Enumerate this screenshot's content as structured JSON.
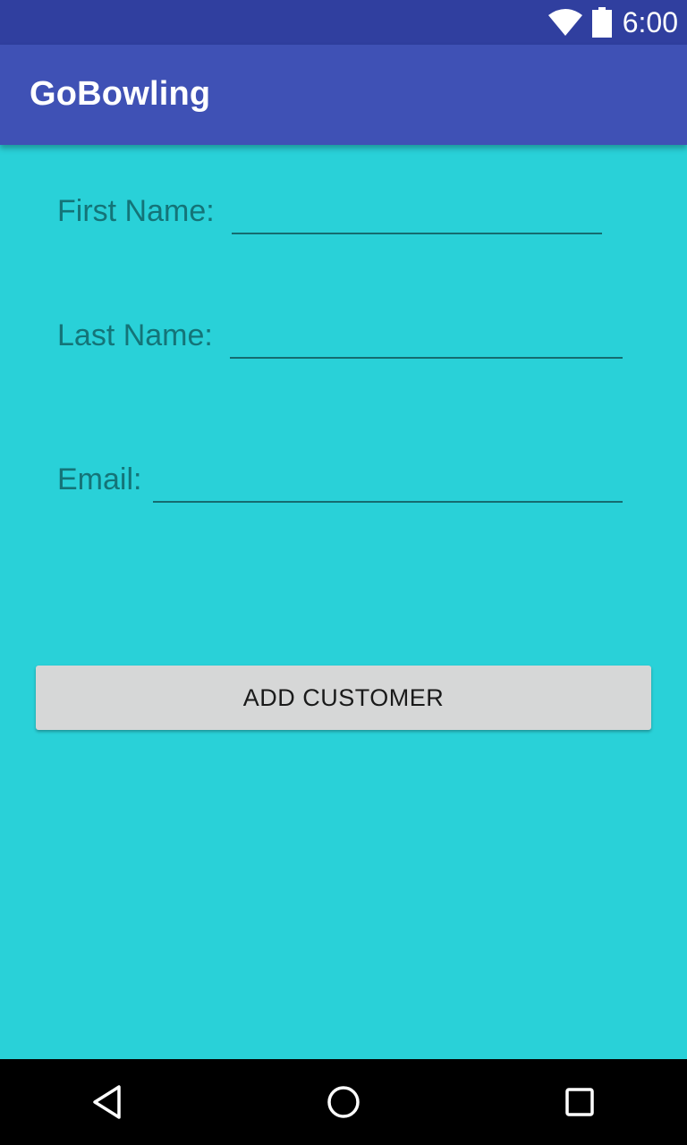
{
  "status_bar": {
    "time": "6:00",
    "icons": [
      "wifi-icon",
      "battery-icon"
    ]
  },
  "app_bar": {
    "title": "GoBowling"
  },
  "form": {
    "first_name": {
      "label": "First Name:",
      "value": "",
      "placeholder": ""
    },
    "last_name": {
      "label": "Last Name:",
      "value": "",
      "placeholder": ""
    },
    "email": {
      "label": "Email:",
      "value": "",
      "placeholder": ""
    },
    "submit_label": "ADD CUSTOMER"
  },
  "nav_bar": {
    "icons": [
      "back-icon",
      "home-icon",
      "recents-icon"
    ]
  },
  "colors": {
    "status_bar": "#303F9F",
    "app_bar": "#3F51B5",
    "background": "#29D1D8",
    "label_text": "#147478",
    "button": "#D6D7D7"
  }
}
